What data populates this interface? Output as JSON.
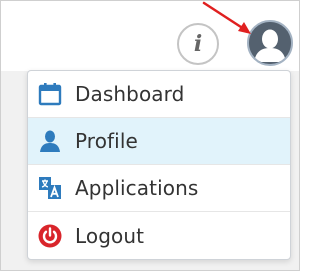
{
  "header": {
    "info_icon_glyph": "i",
    "info_icon": "info-icon",
    "avatar_icon": "user-avatar-icon"
  },
  "annotation": {
    "arrow_color": "#e02020"
  },
  "menu": {
    "items": [
      {
        "label": "Dashboard",
        "icon": "calendar-icon",
        "icon_color": "#2e7bbd",
        "active": false
      },
      {
        "label": "Profile",
        "icon": "user-icon",
        "icon_color": "#2e7bbd",
        "active": true
      },
      {
        "label": "Applications",
        "icon": "translate-icon",
        "icon_color": "#2e7bbd",
        "active": false
      },
      {
        "label": "Logout",
        "icon": "power-icon",
        "icon_color": "#d9252b",
        "active": false
      }
    ]
  },
  "colors": {
    "active_bg": "#e1f3fb",
    "accent": "#2e7bbd",
    "danger": "#d9252b"
  }
}
